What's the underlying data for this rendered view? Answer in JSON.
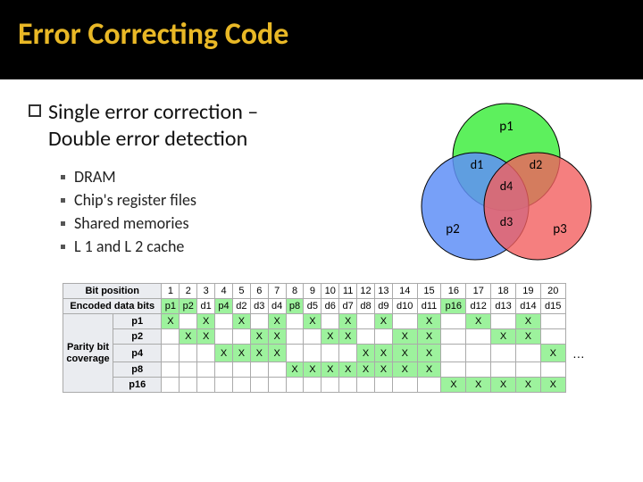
{
  "title": "Error Correcting Code",
  "heading_line1": "Single error correction –",
  "heading_line2": "Double error detection",
  "sublist": [
    "DRAM",
    "Chip's register files",
    "Shared memories",
    "L 1 and L 2 cache"
  ],
  "venn": {
    "p1": "p1",
    "p2": "p2",
    "p3": "p3",
    "d1": "d1",
    "d2": "d2",
    "d3": "d3",
    "d4": "d4"
  },
  "table": {
    "row_head_bitpos": "Bit position",
    "row_head_encoded": "Encoded data bits",
    "parity_head": "Parity bit coverage",
    "positions": [
      "1",
      "2",
      "3",
      "4",
      "5",
      "6",
      "7",
      "8",
      "9",
      "10",
      "11",
      "12",
      "13",
      "14",
      "15",
      "16",
      "17",
      "18",
      "19",
      "20"
    ],
    "encoded": [
      "p1",
      "p2",
      "d1",
      "p4",
      "d2",
      "d3",
      "d4",
      "p8",
      "d5",
      "d6",
      "d7",
      "d8",
      "d9",
      "d10",
      "d11",
      "p16",
      "d12",
      "d13",
      "d14",
      "d15"
    ],
    "parity_green_cols": [
      0,
      1,
      3,
      7,
      15
    ],
    "rows": [
      {
        "name": "p1",
        "x": [
          1,
          3,
          5,
          7,
          9,
          11,
          13,
          15,
          17,
          19
        ]
      },
      {
        "name": "p2",
        "x": [
          2,
          3,
          6,
          7,
          10,
          11,
          14,
          15,
          18,
          19
        ]
      },
      {
        "name": "p4",
        "x": [
          4,
          5,
          6,
          7,
          12,
          13,
          14,
          15,
          20
        ]
      },
      {
        "name": "p8",
        "x": [
          8,
          9,
          10,
          11,
          12,
          13,
          14,
          15
        ]
      },
      {
        "name": "p16",
        "x": [
          16,
          17,
          18,
          19,
          20
        ]
      }
    ],
    "ellipsis": "…"
  }
}
